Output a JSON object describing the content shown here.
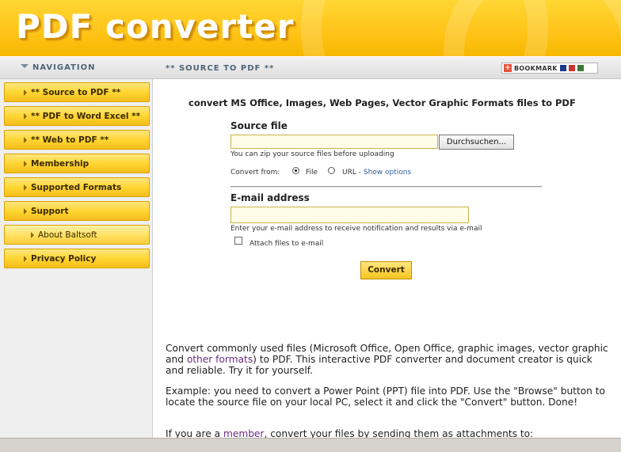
{
  "header": {
    "logo_text": "PDF converter"
  },
  "navigation": {
    "title": "NAVIGATION"
  },
  "topbar": {
    "section_title": "** SOURCE TO PDF **",
    "bookmark_label": "BOOKMARK"
  },
  "sidebar": {
    "items": [
      {
        "label": "** Source to PDF **",
        "sub": false
      },
      {
        "label": "** PDF to Word Excel **",
        "sub": false
      },
      {
        "label": "** Web to PDF **",
        "sub": false
      },
      {
        "label": "Membership",
        "sub": false
      },
      {
        "label": "Supported Formats",
        "sub": false
      },
      {
        "label": "Support",
        "sub": false
      },
      {
        "label": "About Baltsoft",
        "sub": true
      },
      {
        "label": "Privacy Policy",
        "sub": false
      }
    ]
  },
  "form": {
    "headline": "convert MS Office, Images, Web Pages, Vector Graphic Formats files to PDF",
    "source_label": "Source file",
    "source_value": "",
    "browse_label": "Durchsuchen...",
    "zip_hint": "You can zip your source files before uploading",
    "convert_from_label": "Convert from:",
    "option_file": "File",
    "option_url": "URL",
    "option_separator": "-",
    "show_options": "Show options",
    "selected_option": "File",
    "email_label": "E-mail address",
    "email_value": "",
    "email_hint": "Enter your e-mail address to receive notification and results via e-mail",
    "attach_label": "Attach files to e-mail",
    "attach_checked": false,
    "convert_button": "Convert"
  },
  "content": {
    "p1_part1": "Convert commonly used files (Microsoft Office, Open Office, graphic images, vector graphic and ",
    "p1_link": "other formats",
    "p1_part2": ") to PDF. This interactive PDF converter and document creator is quick and reliable. Try it for yourself.",
    "p2": "Example: you need to convert a Power Point (PPT) file into PDF. Use the \"Browse\" button to locate the source file on your local PC, select it and click the \"Convert\" button. Done!",
    "p3_part1": "If you are a ",
    "p3_link": "member",
    "p3_part2": ", convert your files by sending them as attachments to:"
  },
  "colors": {
    "accent": "#ffd633",
    "link": "#2f5f9a",
    "nav_text": "#4e6478"
  }
}
